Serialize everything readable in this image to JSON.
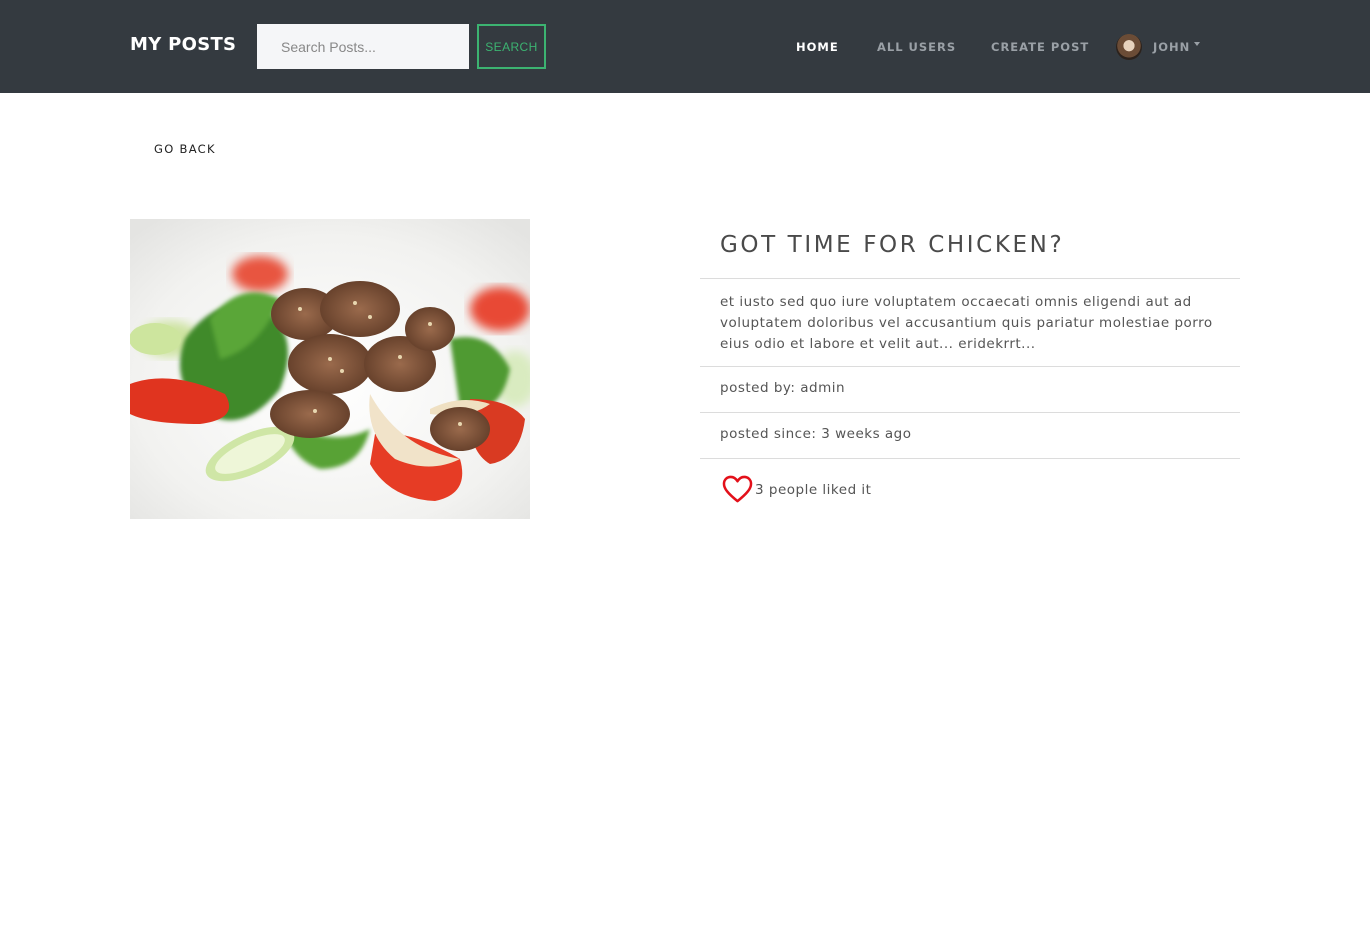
{
  "navbar": {
    "brand": "MY POSTS",
    "search_placeholder": "Search Posts...",
    "search_button": "SEARCH",
    "links": {
      "home": "HOME",
      "all_users": "ALL USERS",
      "create_post": "CREATE POST"
    },
    "user": {
      "name": "JOHN",
      "avatar_icon": "user-avatar"
    }
  },
  "page": {
    "go_back": "GO BACK"
  },
  "post": {
    "image_alt": "chicken salad",
    "title": "GOT TIME FOR CHICKEN?",
    "description": "et iusto sed quo iure voluptatem occaecati omnis eligendi aut ad voluptatem doloribus vel accusantium quis pariatur molestiae porro eius odio et labore et velit aut... eridekrrt...",
    "posted_by": "posted by: admin",
    "posted_since": "posted since: 3 weeks ago",
    "likes_text": "3 people liked it",
    "like_icon": "heart-icon"
  },
  "colors": {
    "navbar_bg": "#343a40",
    "accent_green": "#3cb371",
    "heart_red": "#e3101a",
    "nav_active": "#ffffff",
    "nav_muted": "#9aa0a6"
  }
}
